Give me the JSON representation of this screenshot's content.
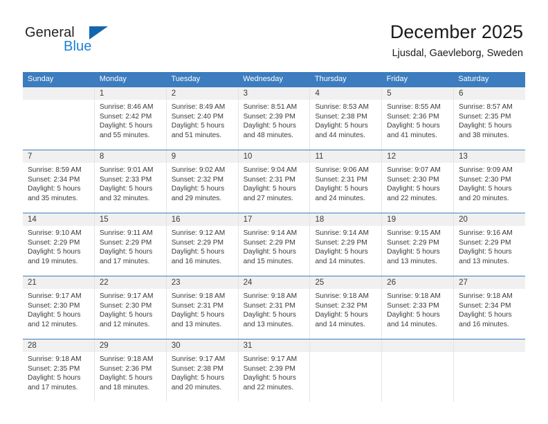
{
  "brand": {
    "line1": "General",
    "line2": "Blue",
    "triangle_color": "#1266b0",
    "blue_color": "#1c7fd4"
  },
  "header": {
    "title": "December 2025",
    "subtitle": "Ljusdal, Gaevleborg, Sweden"
  },
  "theme": {
    "header_blue": "#3c7cbf",
    "daynum_bg": "#f0f0f0",
    "cell_border": "#e4e4e4",
    "text": "#3a3a3a"
  },
  "calendar": {
    "weekdays": [
      "Sunday",
      "Monday",
      "Tuesday",
      "Wednesday",
      "Thursday",
      "Friday",
      "Saturday"
    ],
    "weeks": [
      [
        {
          "day": "",
          "sunrise": "",
          "sunset": "",
          "daylight_line1": "",
          "daylight_line2": ""
        },
        {
          "day": "1",
          "sunrise": "Sunrise: 8:46 AM",
          "sunset": "Sunset: 2:42 PM",
          "daylight_line1": "Daylight: 5 hours",
          "daylight_line2": "and 55 minutes."
        },
        {
          "day": "2",
          "sunrise": "Sunrise: 8:49 AM",
          "sunset": "Sunset: 2:40 PM",
          "daylight_line1": "Daylight: 5 hours",
          "daylight_line2": "and 51 minutes."
        },
        {
          "day": "3",
          "sunrise": "Sunrise: 8:51 AM",
          "sunset": "Sunset: 2:39 PM",
          "daylight_line1": "Daylight: 5 hours",
          "daylight_line2": "and 48 minutes."
        },
        {
          "day": "4",
          "sunrise": "Sunrise: 8:53 AM",
          "sunset": "Sunset: 2:38 PM",
          "daylight_line1": "Daylight: 5 hours",
          "daylight_line2": "and 44 minutes."
        },
        {
          "day": "5",
          "sunrise": "Sunrise: 8:55 AM",
          "sunset": "Sunset: 2:36 PM",
          "daylight_line1": "Daylight: 5 hours",
          "daylight_line2": "and 41 minutes."
        },
        {
          "day": "6",
          "sunrise": "Sunrise: 8:57 AM",
          "sunset": "Sunset: 2:35 PM",
          "daylight_line1": "Daylight: 5 hours",
          "daylight_line2": "and 38 minutes."
        }
      ],
      [
        {
          "day": "7",
          "sunrise": "Sunrise: 8:59 AM",
          "sunset": "Sunset: 2:34 PM",
          "daylight_line1": "Daylight: 5 hours",
          "daylight_line2": "and 35 minutes."
        },
        {
          "day": "8",
          "sunrise": "Sunrise: 9:01 AM",
          "sunset": "Sunset: 2:33 PM",
          "daylight_line1": "Daylight: 5 hours",
          "daylight_line2": "and 32 minutes."
        },
        {
          "day": "9",
          "sunrise": "Sunrise: 9:02 AM",
          "sunset": "Sunset: 2:32 PM",
          "daylight_line1": "Daylight: 5 hours",
          "daylight_line2": "and 29 minutes."
        },
        {
          "day": "10",
          "sunrise": "Sunrise: 9:04 AM",
          "sunset": "Sunset: 2:31 PM",
          "daylight_line1": "Daylight: 5 hours",
          "daylight_line2": "and 27 minutes."
        },
        {
          "day": "11",
          "sunrise": "Sunrise: 9:06 AM",
          "sunset": "Sunset: 2:31 PM",
          "daylight_line1": "Daylight: 5 hours",
          "daylight_line2": "and 24 minutes."
        },
        {
          "day": "12",
          "sunrise": "Sunrise: 9:07 AM",
          "sunset": "Sunset: 2:30 PM",
          "daylight_line1": "Daylight: 5 hours",
          "daylight_line2": "and 22 minutes."
        },
        {
          "day": "13",
          "sunrise": "Sunrise: 9:09 AM",
          "sunset": "Sunset: 2:30 PM",
          "daylight_line1": "Daylight: 5 hours",
          "daylight_line2": "and 20 minutes."
        }
      ],
      [
        {
          "day": "14",
          "sunrise": "Sunrise: 9:10 AM",
          "sunset": "Sunset: 2:29 PM",
          "daylight_line1": "Daylight: 5 hours",
          "daylight_line2": "and 19 minutes."
        },
        {
          "day": "15",
          "sunrise": "Sunrise: 9:11 AM",
          "sunset": "Sunset: 2:29 PM",
          "daylight_line1": "Daylight: 5 hours",
          "daylight_line2": "and 17 minutes."
        },
        {
          "day": "16",
          "sunrise": "Sunrise: 9:12 AM",
          "sunset": "Sunset: 2:29 PM",
          "daylight_line1": "Daylight: 5 hours",
          "daylight_line2": "and 16 minutes."
        },
        {
          "day": "17",
          "sunrise": "Sunrise: 9:14 AM",
          "sunset": "Sunset: 2:29 PM",
          "daylight_line1": "Daylight: 5 hours",
          "daylight_line2": "and 15 minutes."
        },
        {
          "day": "18",
          "sunrise": "Sunrise: 9:14 AM",
          "sunset": "Sunset: 2:29 PM",
          "daylight_line1": "Daylight: 5 hours",
          "daylight_line2": "and 14 minutes."
        },
        {
          "day": "19",
          "sunrise": "Sunrise: 9:15 AM",
          "sunset": "Sunset: 2:29 PM",
          "daylight_line1": "Daylight: 5 hours",
          "daylight_line2": "and 13 minutes."
        },
        {
          "day": "20",
          "sunrise": "Sunrise: 9:16 AM",
          "sunset": "Sunset: 2:29 PM",
          "daylight_line1": "Daylight: 5 hours",
          "daylight_line2": "and 13 minutes."
        }
      ],
      [
        {
          "day": "21",
          "sunrise": "Sunrise: 9:17 AM",
          "sunset": "Sunset: 2:30 PM",
          "daylight_line1": "Daylight: 5 hours",
          "daylight_line2": "and 12 minutes."
        },
        {
          "day": "22",
          "sunrise": "Sunrise: 9:17 AM",
          "sunset": "Sunset: 2:30 PM",
          "daylight_line1": "Daylight: 5 hours",
          "daylight_line2": "and 12 minutes."
        },
        {
          "day": "23",
          "sunrise": "Sunrise: 9:18 AM",
          "sunset": "Sunset: 2:31 PM",
          "daylight_line1": "Daylight: 5 hours",
          "daylight_line2": "and 13 minutes."
        },
        {
          "day": "24",
          "sunrise": "Sunrise: 9:18 AM",
          "sunset": "Sunset: 2:31 PM",
          "daylight_line1": "Daylight: 5 hours",
          "daylight_line2": "and 13 minutes."
        },
        {
          "day": "25",
          "sunrise": "Sunrise: 9:18 AM",
          "sunset": "Sunset: 2:32 PM",
          "daylight_line1": "Daylight: 5 hours",
          "daylight_line2": "and 14 minutes."
        },
        {
          "day": "26",
          "sunrise": "Sunrise: 9:18 AM",
          "sunset": "Sunset: 2:33 PM",
          "daylight_line1": "Daylight: 5 hours",
          "daylight_line2": "and 14 minutes."
        },
        {
          "day": "27",
          "sunrise": "Sunrise: 9:18 AM",
          "sunset": "Sunset: 2:34 PM",
          "daylight_line1": "Daylight: 5 hours",
          "daylight_line2": "and 16 minutes."
        }
      ],
      [
        {
          "day": "28",
          "sunrise": "Sunrise: 9:18 AM",
          "sunset": "Sunset: 2:35 PM",
          "daylight_line1": "Daylight: 5 hours",
          "daylight_line2": "and 17 minutes."
        },
        {
          "day": "29",
          "sunrise": "Sunrise: 9:18 AM",
          "sunset": "Sunset: 2:36 PM",
          "daylight_line1": "Daylight: 5 hours",
          "daylight_line2": "and 18 minutes."
        },
        {
          "day": "30",
          "sunrise": "Sunrise: 9:17 AM",
          "sunset": "Sunset: 2:38 PM",
          "daylight_line1": "Daylight: 5 hours",
          "daylight_line2": "and 20 minutes."
        },
        {
          "day": "31",
          "sunrise": "Sunrise: 9:17 AM",
          "sunset": "Sunset: 2:39 PM",
          "daylight_line1": "Daylight: 5 hours",
          "daylight_line2": "and 22 minutes."
        },
        {
          "day": "",
          "sunrise": "",
          "sunset": "",
          "daylight_line1": "",
          "daylight_line2": ""
        },
        {
          "day": "",
          "sunrise": "",
          "sunset": "",
          "daylight_line1": "",
          "daylight_line2": ""
        },
        {
          "day": "",
          "sunrise": "",
          "sunset": "",
          "daylight_line1": "",
          "daylight_line2": ""
        }
      ]
    ]
  }
}
